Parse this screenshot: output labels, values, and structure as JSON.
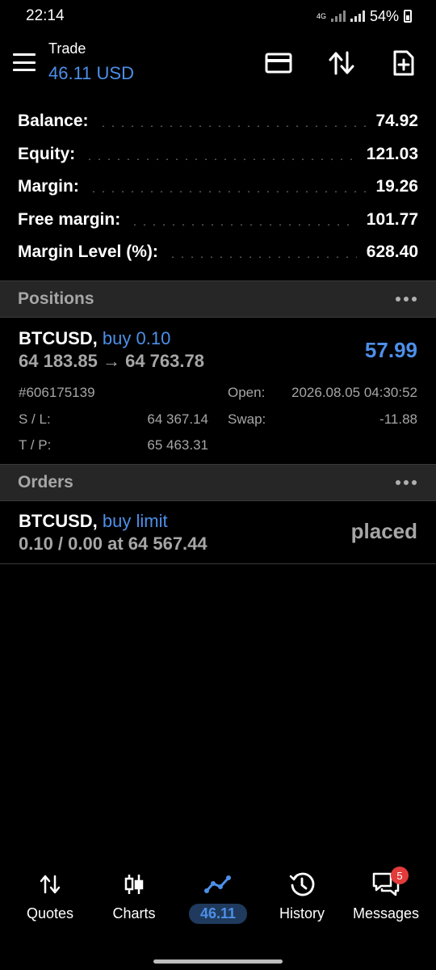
{
  "status_bar": {
    "time": "22:14",
    "network": "4G",
    "battery": "54%"
  },
  "header": {
    "title": "Trade",
    "subtitle": "46.11 USD"
  },
  "summary": [
    {
      "label": "Balance:",
      "value": "74.92"
    },
    {
      "label": "Equity:",
      "value": "121.03"
    },
    {
      "label": "Margin:",
      "value": "19.26"
    },
    {
      "label": "Free margin:",
      "value": "101.77"
    },
    {
      "label": "Margin Level (%):",
      "value": "628.40"
    }
  ],
  "positions": {
    "title": "Positions",
    "item": {
      "symbol": "BTCUSD,",
      "action": "buy 0.10",
      "prices": "64 183.85 → 64 763.78",
      "profit": "57.99",
      "ticket": "#606175139",
      "open_label": "Open:",
      "open_value": "2026.08.05 04:30:52",
      "sl_label": "S / L:",
      "sl_value": "64 367.14",
      "swap_label": "Swap:",
      "swap_value": "-11.88",
      "tp_label": "T / P:",
      "tp_value": "65 463.31"
    }
  },
  "orders": {
    "title": "Orders",
    "item": {
      "symbol": "BTCUSD,",
      "action": "buy limit",
      "details": "0.10 / 0.00 at 64 567.44",
      "status": "placed"
    }
  },
  "bottom_nav": [
    {
      "label": "Quotes",
      "icon": "quotes-arrows-icon"
    },
    {
      "label": "Charts",
      "icon": "candlestick-icon"
    },
    {
      "label": "46.11",
      "icon": "trade-line-icon",
      "active": true
    },
    {
      "label": "History",
      "icon": "history-clock-icon"
    },
    {
      "label": "Messages",
      "icon": "messages-icon",
      "badge": "5"
    }
  ],
  "colors": {
    "accent": "#4d8fe8",
    "muted": "#a6a6a6",
    "section_bg": "#262626",
    "badge": "#e23b3b"
  }
}
